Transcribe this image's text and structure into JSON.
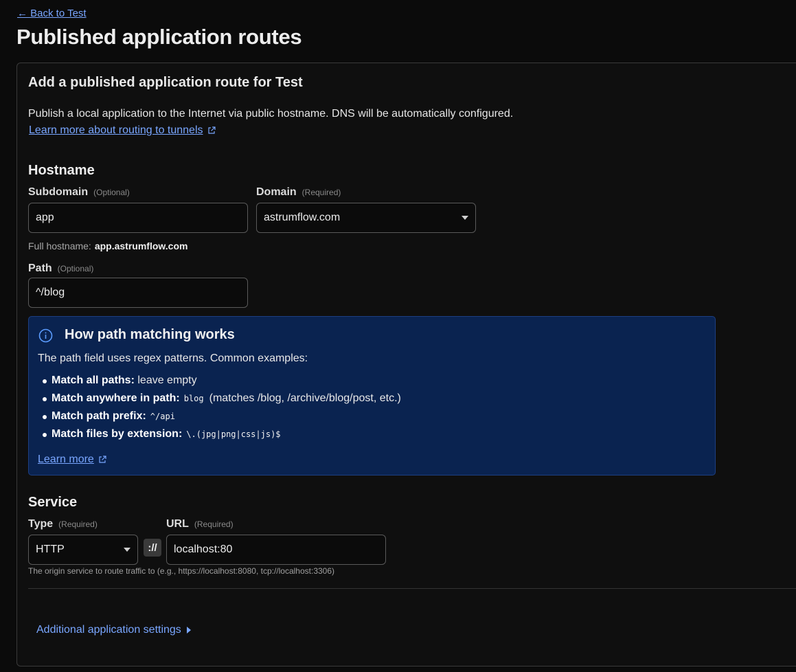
{
  "back_link": "← Back to Test",
  "page_title": "Published application routes",
  "card": {
    "title": "Add a published application route for Test",
    "description": "Publish a local application to the Internet via public hostname. DNS will be automatically configured.",
    "learn_link": "Learn more about routing to tunnels"
  },
  "hostname": {
    "section_title": "Hostname",
    "subdomain": {
      "label": "Subdomain",
      "tag": "(Optional)",
      "value": "app"
    },
    "domain": {
      "label": "Domain",
      "tag": "(Required)",
      "value": "astrumflow.com"
    },
    "full_hostname_label": "Full hostname:",
    "full_hostname_value": "app.astrumflow.com",
    "path": {
      "label": "Path",
      "tag": "(Optional)",
      "value": "^/blog"
    }
  },
  "info": {
    "title": "How path matching works",
    "intro": "The path field uses regex patterns. Common examples:",
    "items": [
      {
        "label": "Match all paths:",
        "code": "",
        "text": "leave empty"
      },
      {
        "label": "Match anywhere in path:",
        "code": "blog",
        "text": "(matches /blog, /archive/blog/post, etc.)"
      },
      {
        "label": "Match path prefix:",
        "code": "^/api",
        "text": ""
      },
      {
        "label": "Match files by extension:",
        "code": "\\.(jpg|png|css|js)$",
        "text": ""
      }
    ],
    "learn_more": "Learn more"
  },
  "service": {
    "section_title": "Service",
    "type": {
      "label": "Type",
      "tag": "(Required)",
      "value": "HTTP"
    },
    "scheme_separator": "://",
    "url": {
      "label": "URL",
      "tag": "(Required)",
      "value": "localhost:80"
    },
    "hint": "The origin service to route traffic to (e.g., https://localhost:8080, tcp://localhost:3306)"
  },
  "additional_settings": "Additional application settings",
  "icons": {
    "external_link": "external-link-icon",
    "info": "info-icon",
    "caret": "chevron-down-icon",
    "chevron_right": "chevron-right-icon"
  },
  "colors": {
    "background": "#0b0b0b",
    "link": "#79a6ff",
    "info_bg": "#0a2350",
    "info_border": "#1d3f82"
  }
}
